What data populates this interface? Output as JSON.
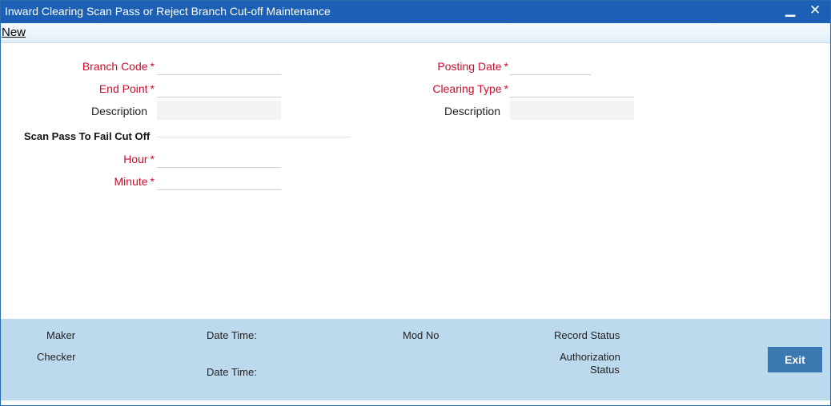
{
  "window": {
    "title": "Inward Clearing Scan Pass or Reject Branch Cut-off Maintenance",
    "minimize_glyph": "▁",
    "close_glyph": "✕"
  },
  "toolbar": {
    "new_label": "New"
  },
  "form": {
    "required_mark": "*",
    "branch_code_label": "Branch Code",
    "end_point_label": "End Point",
    "description_left_label": "Description",
    "posting_date_label": "Posting Date",
    "clearing_type_label": "Clearing Type",
    "description_right_label": "Description",
    "branch_code_value": "",
    "end_point_value": "",
    "description_left_value": "",
    "posting_date_value": "",
    "clearing_type_value": "",
    "description_right_value": ""
  },
  "section": {
    "title": "Scan Pass To Fail Cut Off",
    "hour_label": "Hour",
    "minute_label": "Minute",
    "hour_value": "",
    "minute_value": ""
  },
  "footer": {
    "maker_label": "Maker",
    "checker_label": "Checker",
    "date_time_label": "Date Time:",
    "mod_no_label": "Mod No",
    "record_status_label": "Record Status",
    "authorization_label": "Authorization",
    "status_label": "Status",
    "exit_label": "Exit"
  },
  "colors": {
    "titlebar": "#1b60b4",
    "required": "#c8102e",
    "footer": "#bcd9ee",
    "exit_button": "#3a78b0"
  }
}
